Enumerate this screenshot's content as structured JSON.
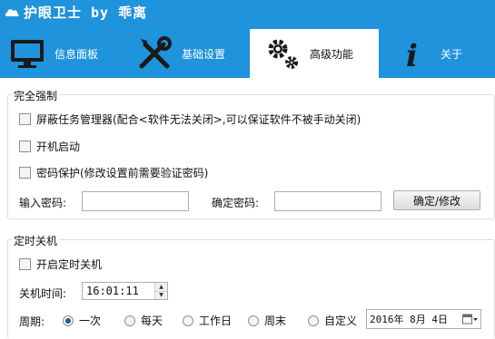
{
  "window": {
    "title": "护眼卫士 by 乖离"
  },
  "tabs": [
    {
      "label": "信息面板",
      "icon": "monitor-icon"
    },
    {
      "label": "基础设置",
      "icon": "tools-icon"
    },
    {
      "label": "高级功能",
      "icon": "gears-icon"
    },
    {
      "label": "关于",
      "icon": "info-icon"
    }
  ],
  "force_group": {
    "legend": "完全强制",
    "options": [
      {
        "label": "屏蔽任务管理器(配合<软件无法关闭>,可以保证软件不被手动关闭)",
        "checked": false
      },
      {
        "label": "开机启动",
        "checked": false
      },
      {
        "label": "密码保护(修改设置前需要验证密码)",
        "checked": false
      }
    ],
    "password_label": "输入密码:",
    "password_value": "",
    "confirm_label": "确定密码:",
    "confirm_value": "",
    "confirm_button": "确定/修改"
  },
  "shutdown_group": {
    "legend": "定时关机",
    "enable_label": "开启定时关机",
    "enable_checked": false,
    "time_label": "关机时间:",
    "time_value": "16:01:11",
    "period_label": "周期:",
    "period_options": [
      "一次",
      "每天",
      "工作日",
      "周末",
      "自定义"
    ],
    "period_selected": "一次",
    "date_value": "2016年 8月 4日"
  },
  "colors": {
    "accent": "#1f93dc",
    "active_tab_bg": "#ffffff"
  }
}
